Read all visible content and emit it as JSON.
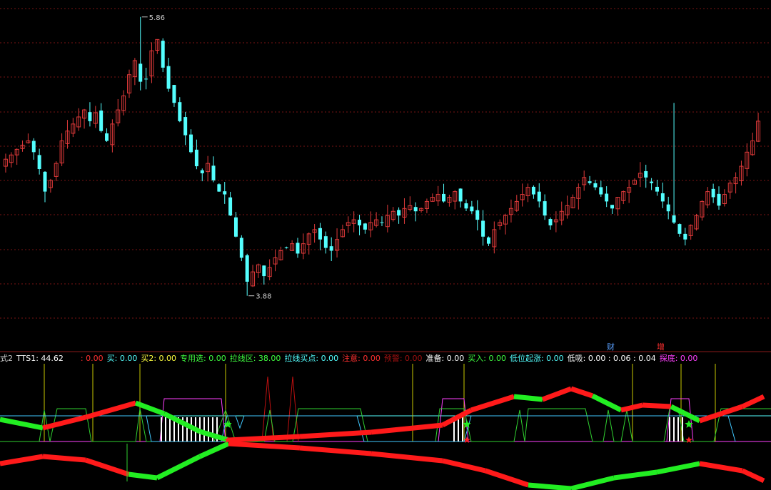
{
  "price_chart": {
    "high_label": "5.86",
    "low_label": "3.88",
    "colors": {
      "up": "#e03a3a",
      "down": "#54ffff",
      "grid": "#7a1414"
    }
  },
  "indicator_panel": {
    "badges": [
      {
        "text": "财",
        "color": "#5aa0ff"
      },
      {
        "text": "增",
        "color": "#ff3030"
      }
    ],
    "legend": [
      {
        "text": "式2",
        "color": "#c8c8c8"
      },
      {
        "text": "TTS1: 44.62",
        "color": "#ffffff"
      },
      {
        "text": ": 0.00",
        "color": "#ff3030"
      },
      {
        "text": "买: 0.00",
        "color": "#54ffff"
      },
      {
        "text": "买2: 0.00",
        "color": "#ffff40"
      },
      {
        "text": "专用选: 0.00",
        "color": "#40ff40"
      },
      {
        "text": "拉线区: 38.00",
        "color": "#40ff40"
      },
      {
        "text": "拉线买点: 0.00",
        "color": "#54ffff"
      },
      {
        "text": "注意: 0.00",
        "color": "#ff3030"
      },
      {
        "text": "预警: 0.00",
        "color": "#a01010"
      },
      {
        "text": "准备: 0.00",
        "color": "#ffffff"
      },
      {
        "text": "买入: 0.00",
        "color": "#40ff40"
      },
      {
        "text": "低位起涨: 0.00",
        "color": "#54ffff"
      },
      {
        "text": "低吸: 0.00 : 0.06 : 0.04",
        "color": "#ffffff"
      },
      {
        "text": "探底: 0.00",
        "color": "#ff40ff"
      }
    ]
  },
  "chart_data": {
    "type": "candlestick",
    "y_range": [
      3.6,
      5.95
    ],
    "high": 5.86,
    "low": 3.88,
    "closes": [
      4.85,
      4.88,
      4.92,
      4.95,
      4.98,
      4.9,
      4.78,
      4.62,
      4.7,
      4.82,
      4.98,
      5.05,
      5.1,
      5.15,
      5.2,
      5.12,
      5.18,
      5.05,
      4.98,
      5.1,
      5.2,
      5.3,
      5.45,
      5.55,
      5.4,
      5.42,
      5.62,
      5.7,
      5.5,
      5.35,
      5.25,
      5.12,
      5.02,
      4.9,
      4.8,
      4.75,
      4.82,
      4.7,
      4.62,
      4.6,
      4.45,
      4.3,
      4.15,
      3.98,
      4.05,
      4.1,
      4.02,
      4.08,
      4.15,
      4.2,
      4.22,
      4.25,
      4.18,
      4.25,
      4.32,
      4.35,
      4.28,
      4.22,
      4.2,
      4.28,
      4.35,
      4.4,
      4.42,
      4.38,
      4.35,
      4.4,
      4.42,
      4.4,
      4.45,
      4.48,
      4.45,
      4.5,
      4.52,
      4.48,
      4.5,
      4.55,
      4.58,
      4.6,
      4.55,
      4.58,
      4.62,
      4.55,
      4.5,
      4.48,
      4.42,
      4.3,
      4.25,
      4.35,
      4.4,
      4.45,
      4.5,
      4.55,
      4.6,
      4.65,
      4.6,
      4.55,
      4.45,
      4.38,
      4.42,
      4.48,
      4.52,
      4.58,
      4.65,
      4.72,
      4.68,
      4.65,
      4.6,
      4.55,
      4.5,
      4.58,
      4.62,
      4.65,
      4.7,
      4.75,
      4.72,
      4.68,
      4.62,
      4.55,
      4.48,
      4.4,
      4.32,
      4.28,
      4.38,
      4.45,
      4.55,
      4.62,
      4.58,
      4.52,
      4.6,
      4.68,
      4.72,
      4.8,
      4.9,
      4.98,
      5.12
    ]
  }
}
